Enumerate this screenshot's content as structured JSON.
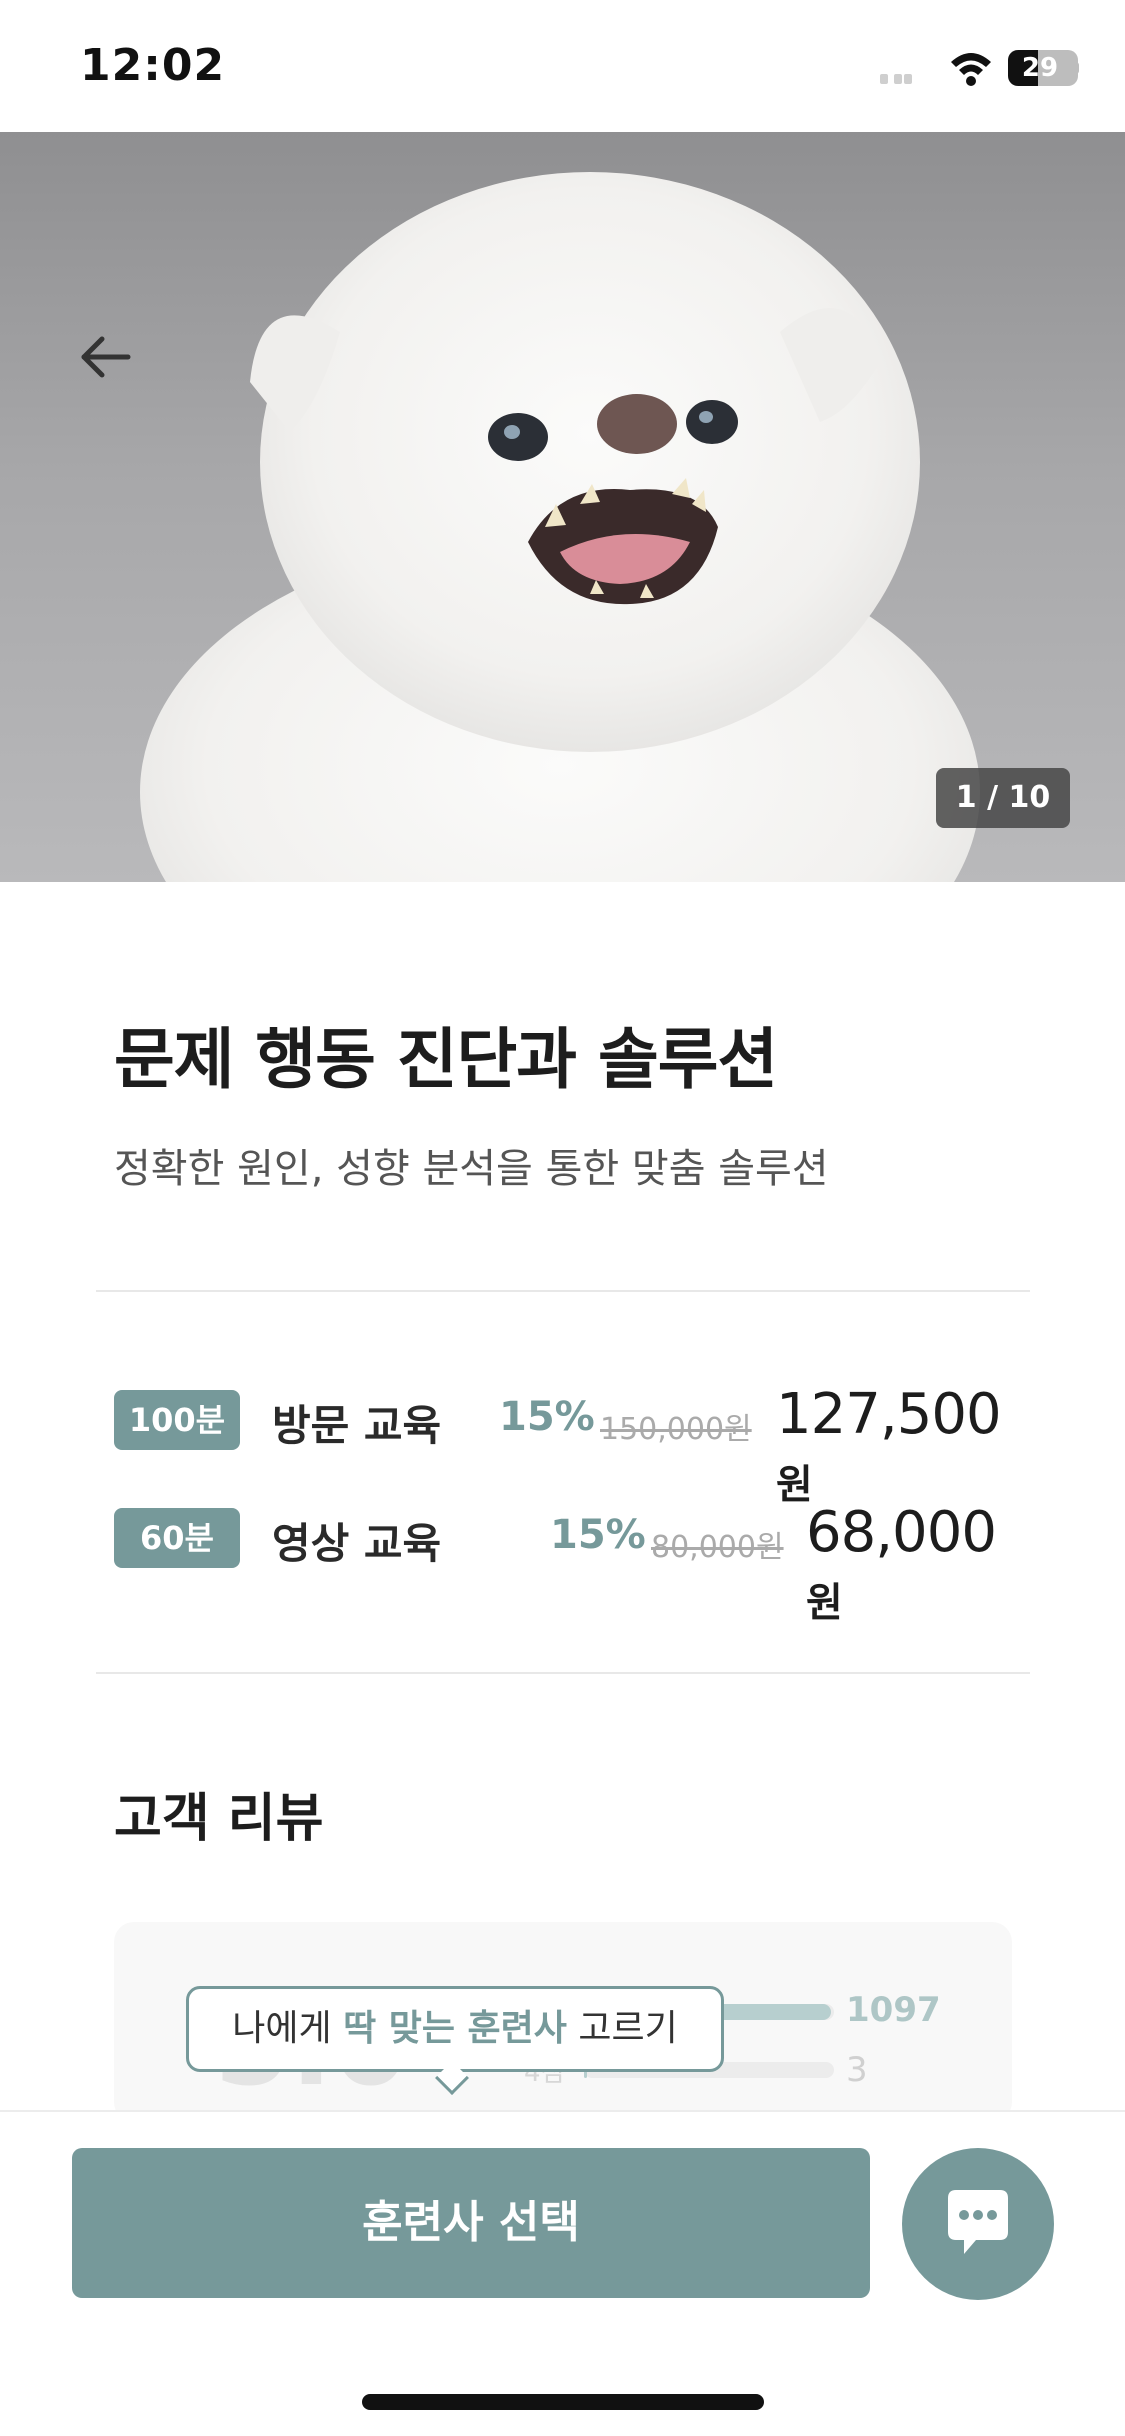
{
  "status_bar": {
    "time": "12:02",
    "battery": "29"
  },
  "hero": {
    "pager": "1 / 10"
  },
  "product": {
    "title": "문제 행동 진단과 솔루션",
    "subtitle": "정확한 원인, 성향 분석을 통한 맞춤 솔루션"
  },
  "prices": [
    {
      "duration": "100분",
      "name": "방문 교육",
      "discount": "15%",
      "original": "150,000원",
      "final": "127,500",
      "unit": "원"
    },
    {
      "duration": "60분",
      "name": "영상 교육",
      "discount": "15%",
      "original": "80,000원",
      "final": "68,000",
      "unit": "원"
    }
  ],
  "reviews": {
    "title": "고객 리뷰",
    "rating": "5.0",
    "bars": [
      {
        "label": "5점",
        "count": "1097",
        "fraction": 0.99
      },
      {
        "label": "4점",
        "count": "3",
        "fraction": 0.01
      }
    ]
  },
  "tooltip": {
    "prefix": "나에게 ",
    "highlight": "딱 맞는 훈련사",
    "suffix": " 고르기"
  },
  "bottom": {
    "cta_label": "훈련사 선택"
  },
  "colors": {
    "accent": "#76999a"
  },
  "icons": {
    "back": "arrow-left-icon",
    "chat": "chat-bubble-icon",
    "wifi": "wifi-icon",
    "battery": "battery-icon"
  }
}
